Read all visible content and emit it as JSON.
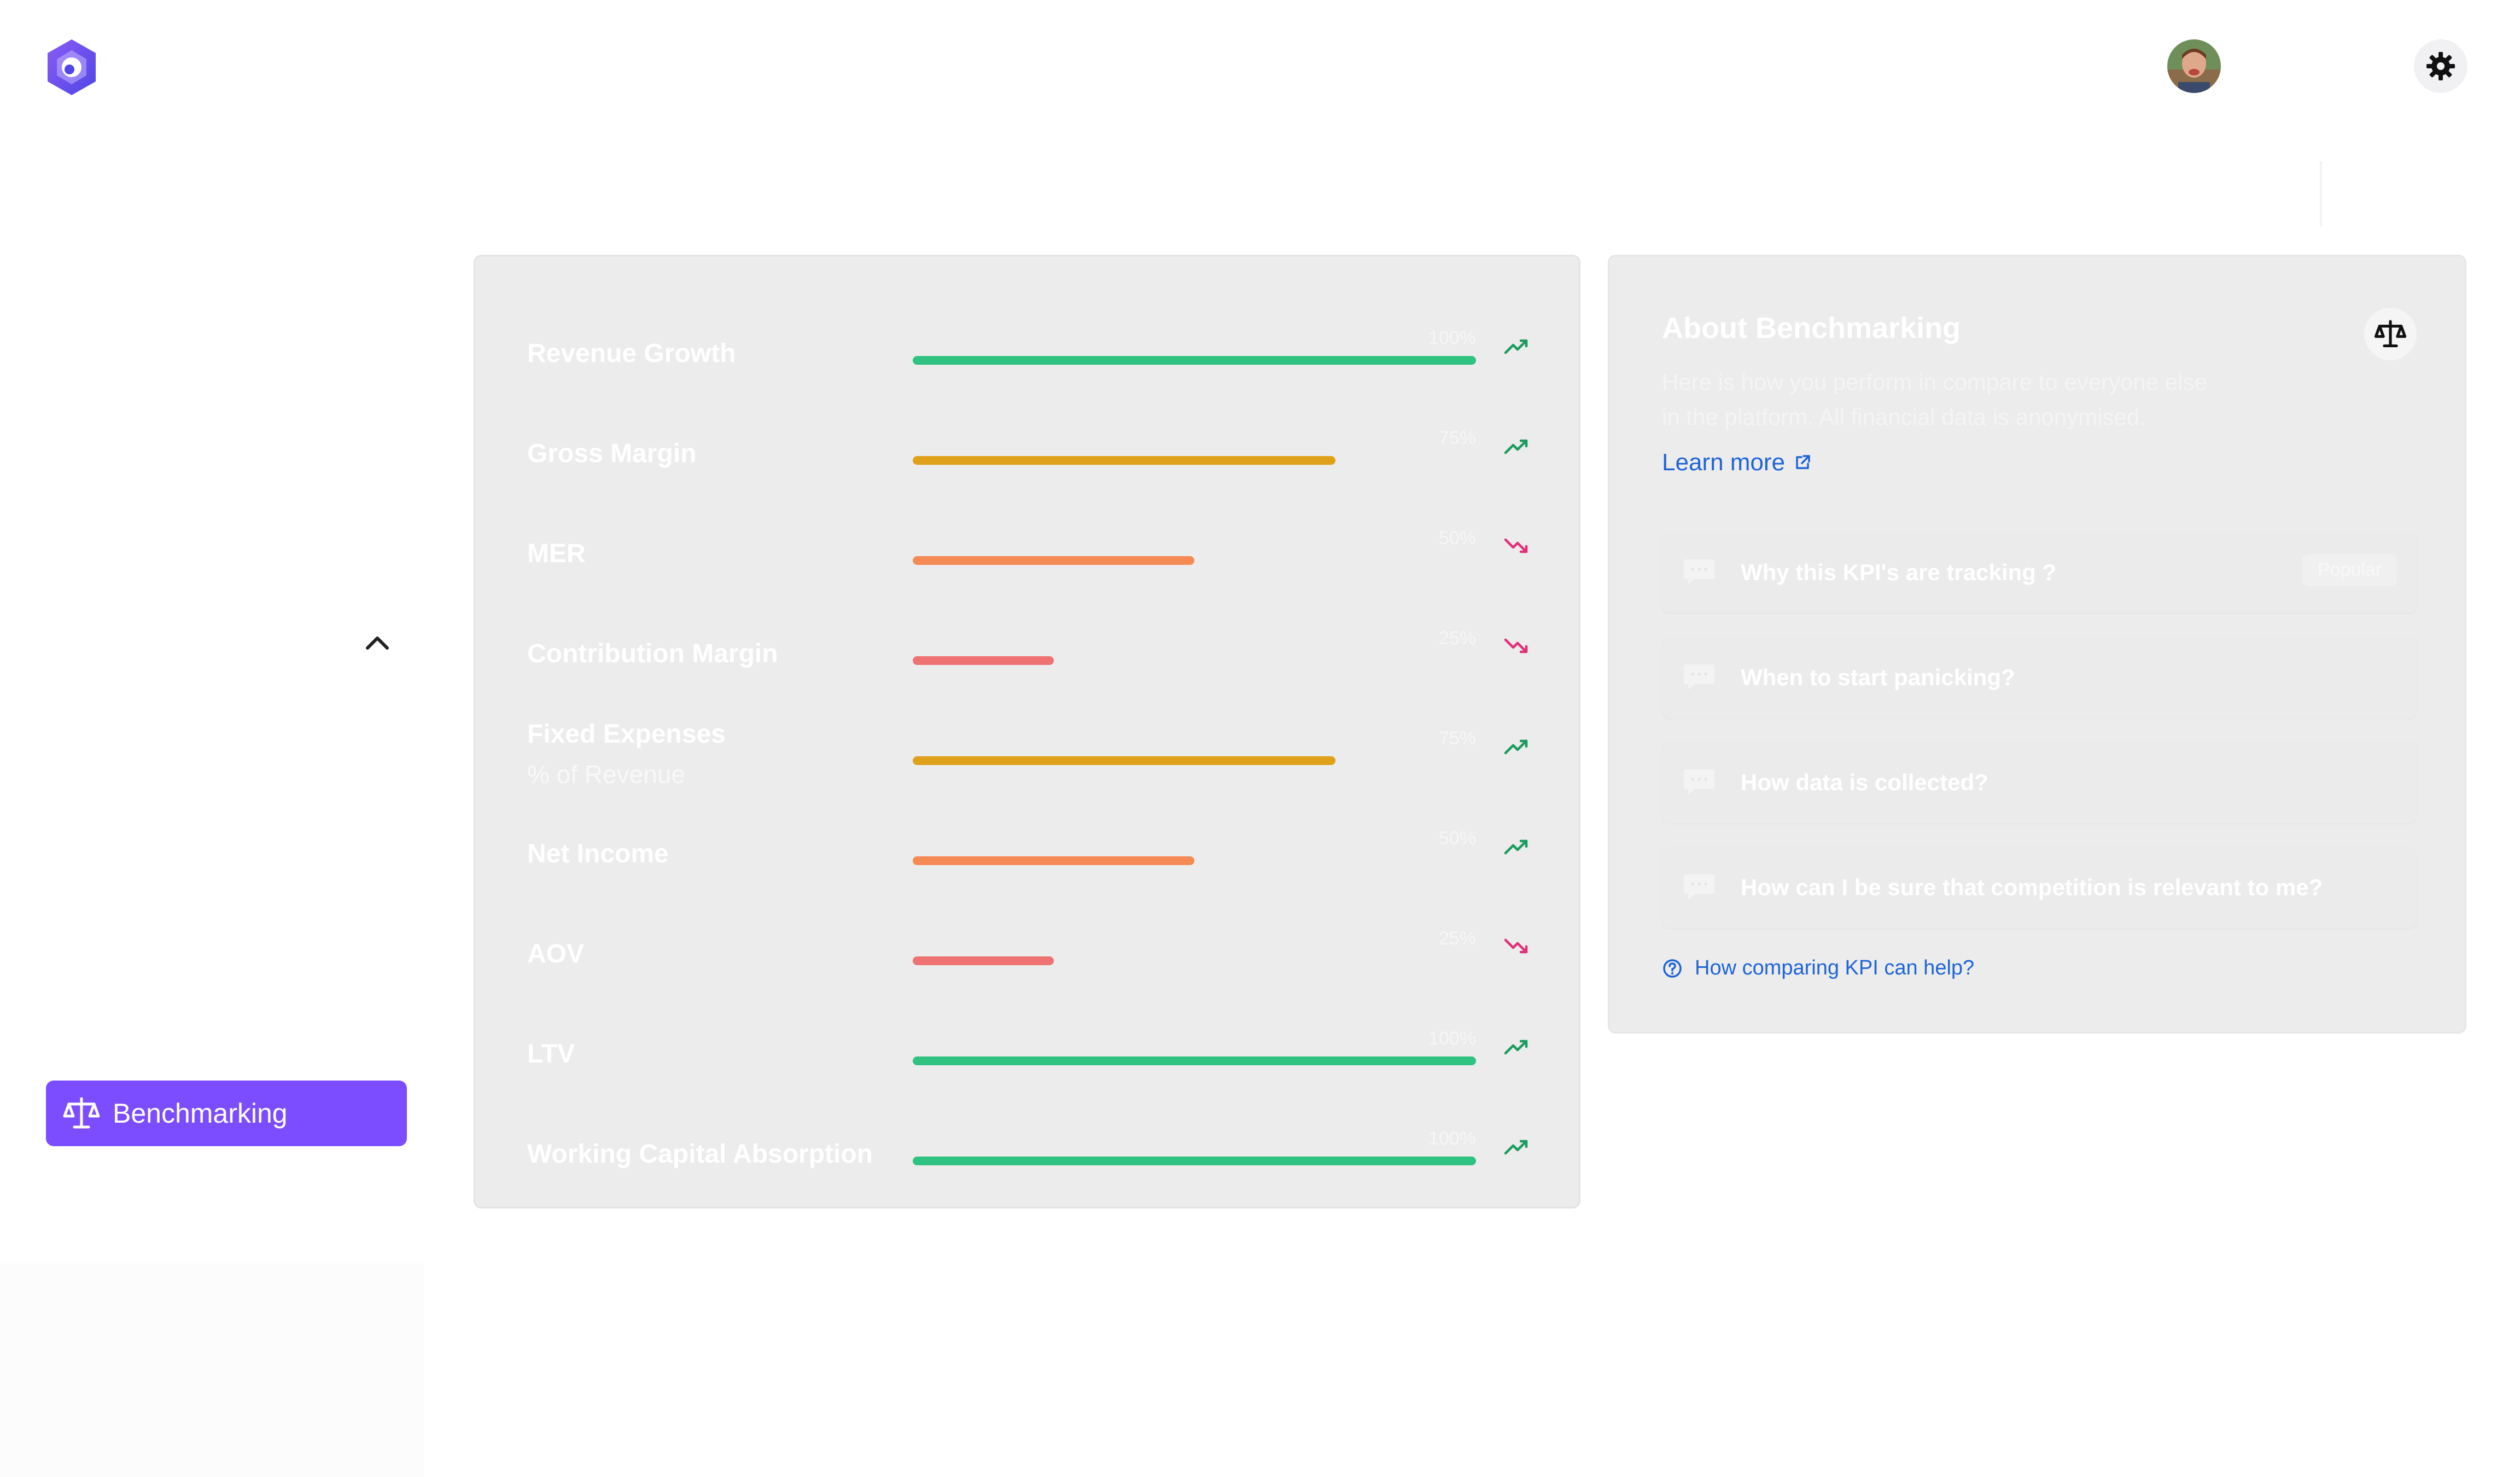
{
  "sidebar": {
    "logo_icon": "hexagon-logo-icon",
    "collapse_icon": "chevron-up-icon",
    "active_item": {
      "label": "Benchmarking",
      "icon": "balance-scale-icon"
    }
  },
  "header": {
    "avatar": "user-avatar",
    "settings_icon": "gear-icon"
  },
  "kpis": [
    {
      "label": "Revenue Growth",
      "sub": "",
      "percent_label": "100%",
      "value": 1.0,
      "color": "#2fc281",
      "trend": "up"
    },
    {
      "label": "Gross Margin",
      "sub": "",
      "percent_label": "75%",
      "value": 0.75,
      "color": "#dfa11a",
      "trend": "up"
    },
    {
      "label": "MER",
      "sub": "",
      "percent_label": "50%",
      "value": 0.5,
      "color": "#f58a54",
      "trend": "down"
    },
    {
      "label": "Contribution Margin",
      "sub": "",
      "percent_label": "25%",
      "value": 0.25,
      "color": "#ef7272",
      "trend": "down"
    },
    {
      "label": "Fixed Expenses",
      "sub": "% of Revenue",
      "percent_label": "75%",
      "value": 0.75,
      "color": "#dfa11a",
      "trend": "up"
    },
    {
      "label": "Net Income",
      "sub": "",
      "percent_label": "50%",
      "value": 0.5,
      "color": "#f58a54",
      "trend": "up"
    },
    {
      "label": "AOV",
      "sub": "",
      "percent_label": "25%",
      "value": 0.25,
      "color": "#ef7272",
      "trend": "down"
    },
    {
      "label": "LTV",
      "sub": "",
      "percent_label": "100%",
      "value": 1.0,
      "color": "#2fc281",
      "trend": "up"
    },
    {
      "label": "Working Capital Absorption",
      "sub": "",
      "percent_label": "100%",
      "value": 1.0,
      "color": "#2fc281",
      "trend": "up"
    }
  ],
  "trend_colors": {
    "up": "#1a9c5c",
    "down": "#e0307a"
  },
  "about": {
    "title": "About Benchmarking",
    "description_line1": "Here is how you perform in compare to everyone else",
    "description_line2": "in the platform. All financial data is anonymised.",
    "learn_more": "Learn more",
    "faq": [
      {
        "text": "Why this KPI's are tracking ?",
        "badge": "Popular"
      },
      {
        "text": "When to start panicking?",
        "badge": ""
      },
      {
        "text": "How data is collected?",
        "badge": ""
      },
      {
        "text": "How can I be sure that competition is relevant to me?",
        "badge": ""
      }
    ],
    "help_link": "How comparing KPI can help?"
  }
}
